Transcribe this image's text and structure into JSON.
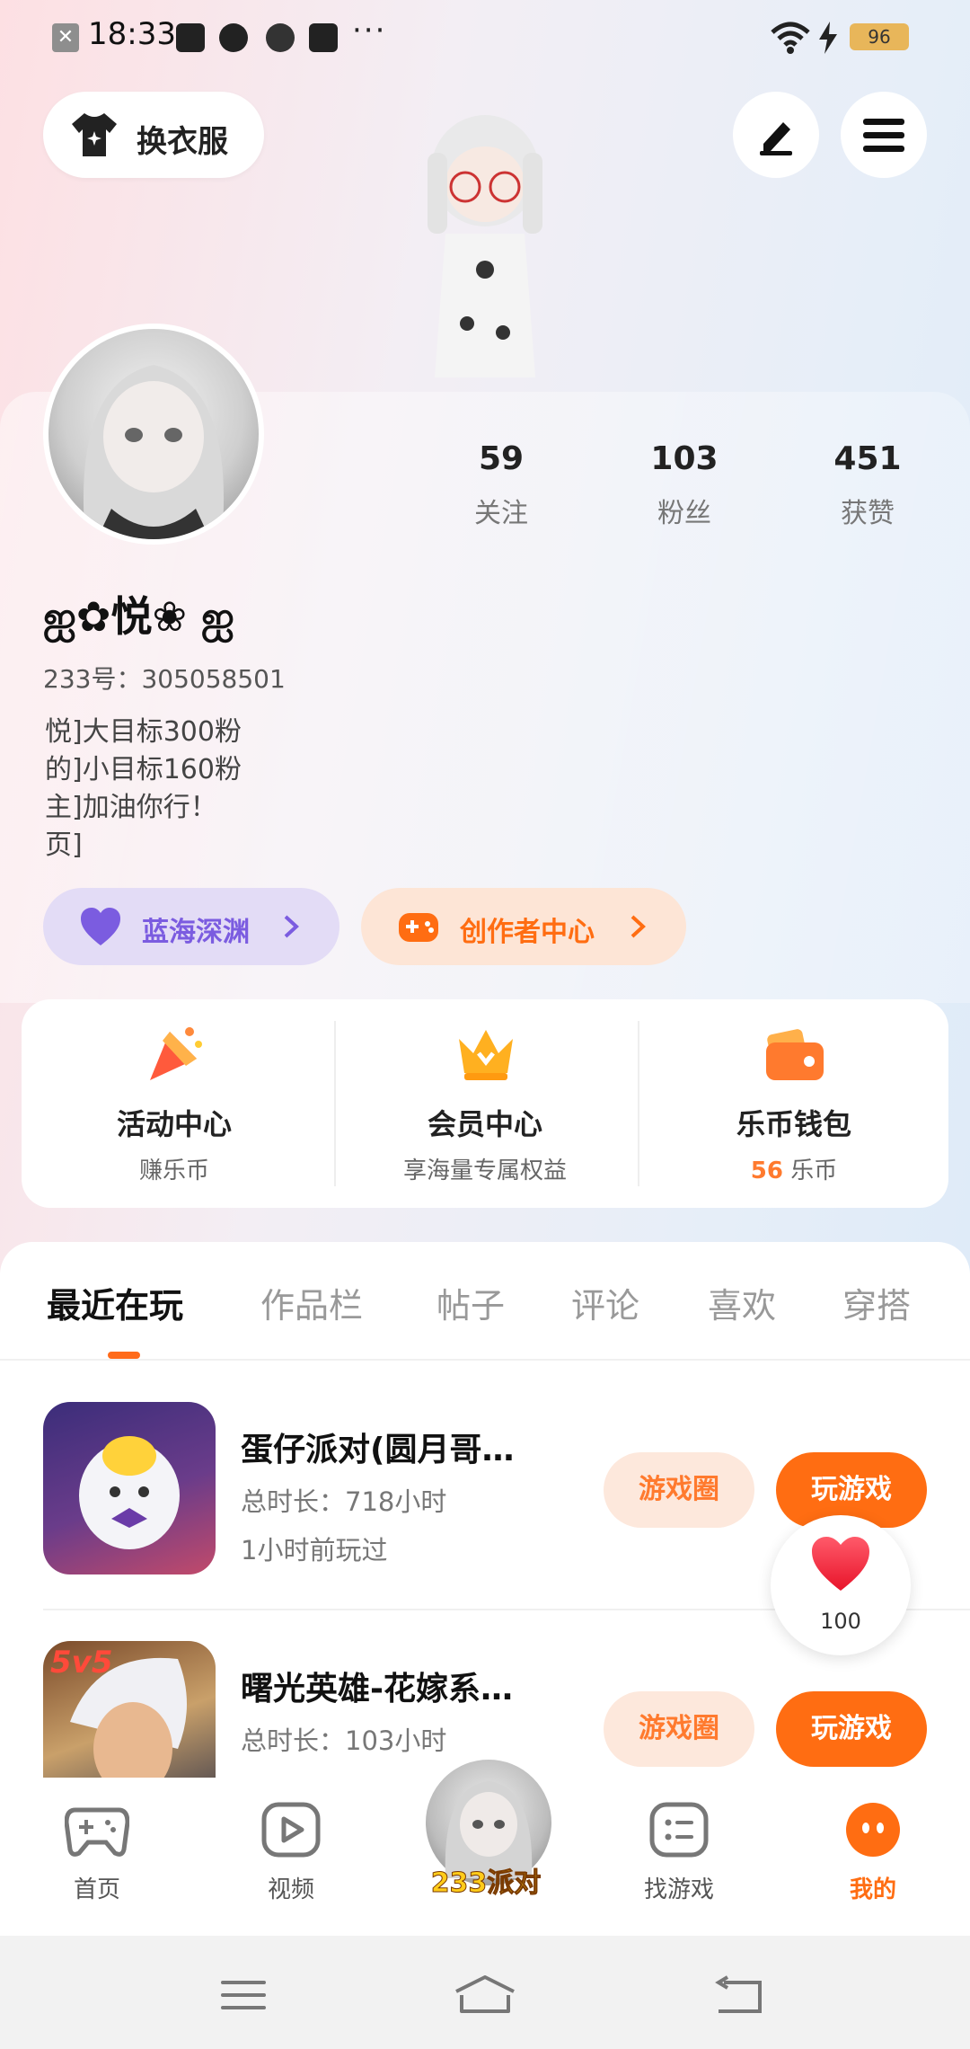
{
  "status_bar": {
    "time": "18:33",
    "battery": "96",
    "more": "···"
  },
  "top": {
    "outfit_label": "换衣服"
  },
  "profile": {
    "username": "ஐ✿悦❀ ஐ",
    "uid_line": "233号：305058501",
    "bio": "悦]大目标300粉\n的]小目标160粉\n主]加油你行！\n页]",
    "stats": [
      {
        "value": "59",
        "label": "关注"
      },
      {
        "value": "103",
        "label": "粉丝"
      },
      {
        "value": "451",
        "label": "获赞"
      }
    ],
    "tags": [
      {
        "label": "蓝海深渊"
      },
      {
        "label": "创作者中心"
      }
    ]
  },
  "quick_entries": [
    {
      "title": "活动中心",
      "subtitle": "赚乐币"
    },
    {
      "title": "会员中心",
      "subtitle": "享海量专属权益"
    },
    {
      "title": "乐币钱包",
      "subtitle_value": "56",
      "subtitle_unit": "乐币"
    }
  ],
  "tabs": [
    "最近在玩",
    "作品栏",
    "帖子",
    "评论",
    "喜欢",
    "穿搭"
  ],
  "games": [
    {
      "title": "蛋仔派对(圆月哥…",
      "duration": "总时长：718小时",
      "last_played": "1小时前玩过",
      "circle_label": "游戏圈",
      "play_label": "玩游戏"
    },
    {
      "title": "曙光英雄-花嫁系…",
      "duration": "总时长：103小时",
      "last_played": "",
      "circle_label": "游戏圈",
      "play_label": "玩游戏",
      "badge": "5v5"
    }
  ],
  "like_float": {
    "count": "100"
  },
  "nav": {
    "items": [
      "首页",
      "视频",
      "找游戏",
      "我的"
    ],
    "center_brand": "233派对"
  },
  "colors": {
    "accent": "#ff6d12",
    "tag_purple": "#7b5ce0",
    "tag_orange": "#ff7a2e"
  }
}
